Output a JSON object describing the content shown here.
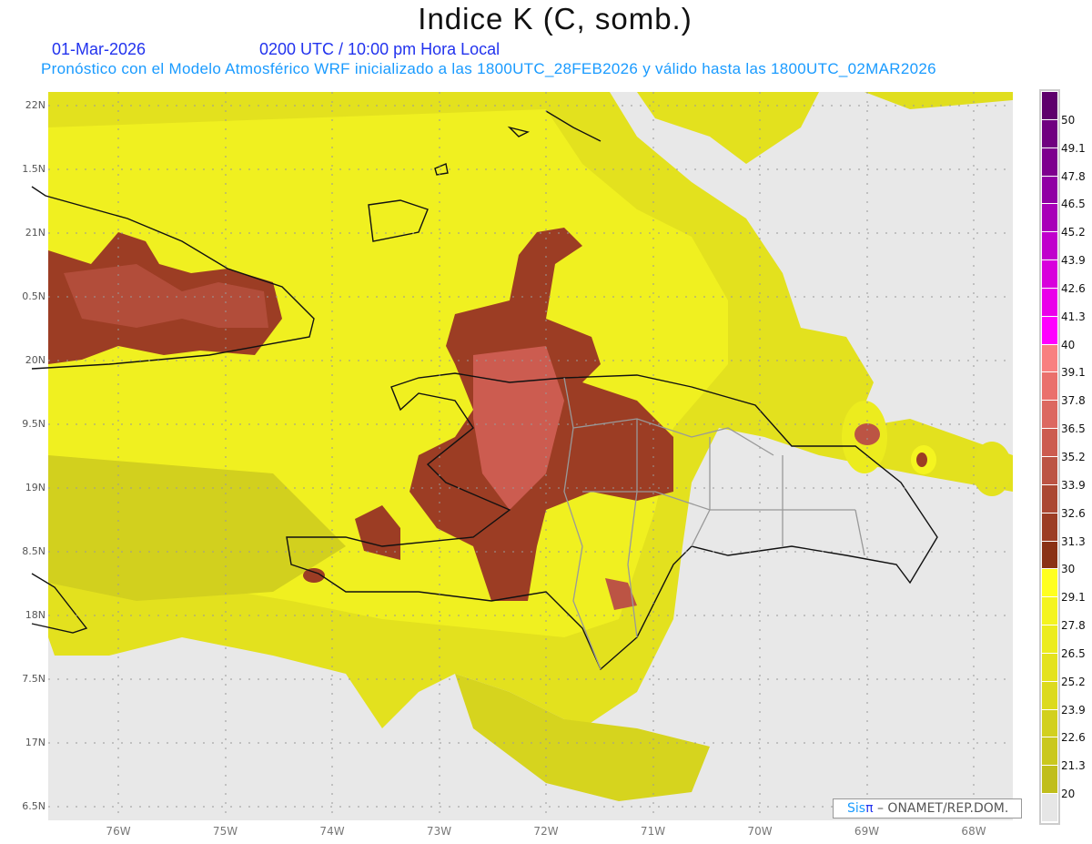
{
  "title": "Indice K (C, somb.)",
  "date": "01-Mar-2026",
  "time": "0200 UTC / 10:00 pm Hora Local",
  "subtitle": "Pronóstico con el Modelo Atmosférico WRF inicializado a las 1800UTC_28FEB2026 y válido hasta las  1800UTC_02MAR2026",
  "lat_labels": [
    "22N",
    "1.5N",
    "21N",
    "0.5N",
    "20N",
    "9.5N",
    "19N",
    "8.5N",
    "18N",
    "7.5N",
    "17N",
    "6.5N"
  ],
  "lon_labels": [
    "76W",
    "75W",
    "74W",
    "73W",
    "72W",
    "71W",
    "70W",
    "69W",
    "68W"
  ],
  "colorbar": {
    "levels": [
      "50",
      "49.1",
      "47.8",
      "46.5",
      "45.2",
      "43.9",
      "42.6",
      "41.3",
      "40",
      "39.1",
      "37.8",
      "36.5",
      "35.2",
      "33.9",
      "32.6",
      "31.3",
      "30",
      "29.1",
      "27.8",
      "26.5",
      "25.2",
      "23.9",
      "22.6",
      "21.3",
      "20"
    ],
    "colors": [
      "#5e006c",
      "#700080",
      "#7e008e",
      "#9000a4",
      "#a800b8",
      "#c000cc",
      "#d800dc",
      "#ea00ea",
      "#ff00ff",
      "#f88080",
      "#ea706c",
      "#dc6860",
      "#cc5c50",
      "#bc5444",
      "#ab4833",
      "#9c3d24",
      "#8a3216",
      "#ffff20",
      "#f4f420",
      "#ecec1e",
      "#e4e21e",
      "#dcda1e",
      "#d2d01e",
      "#cac81e",
      "#c0be1c",
      "#e6e6e6"
    ]
  },
  "credit": {
    "sis": "Sis",
    "pi": "π",
    "text": "– ONAMET/REP.DOM."
  }
}
